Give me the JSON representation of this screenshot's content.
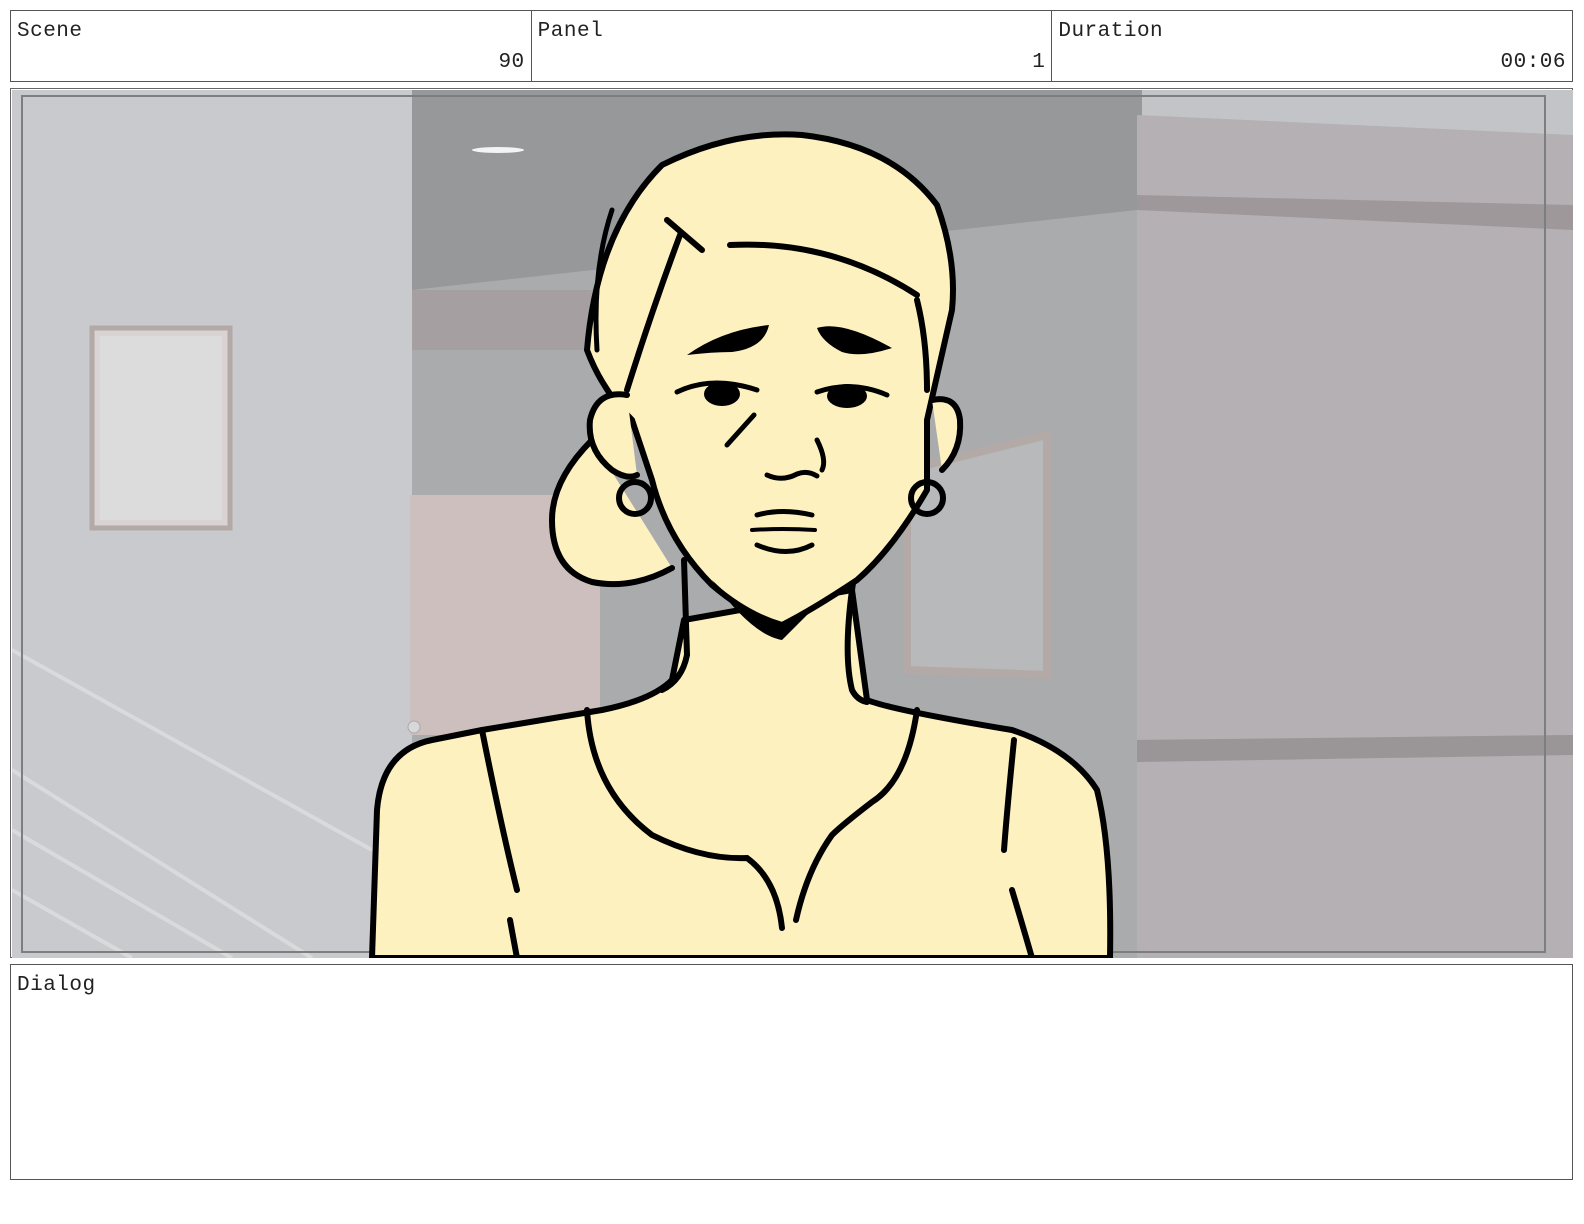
{
  "header": {
    "scene": {
      "label": "Scene",
      "value": "90"
    },
    "panel": {
      "label": "Panel",
      "value": "1"
    },
    "duration": {
      "label": "Duration",
      "value": "00:06"
    }
  },
  "dialog": {
    "label": "Dialog",
    "text": ""
  },
  "colors": {
    "wall_light": "#c9cacd",
    "wall_dark": "#9a9c9e",
    "wall_mauve": "#b7b2b5",
    "door_pink": "#cdbfbe",
    "skin_fill": "#fdf1bf",
    "ink": "#000000"
  }
}
